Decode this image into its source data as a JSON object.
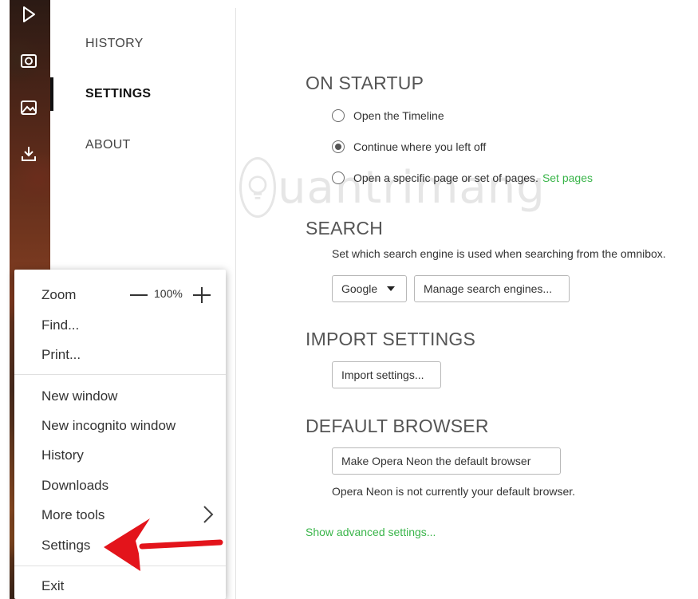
{
  "sidebar": {
    "icons": [
      "play-icon",
      "camera-icon",
      "image-icon",
      "download-icon"
    ]
  },
  "nav": {
    "items": [
      {
        "label": "HISTORY",
        "active": false
      },
      {
        "label": "SETTINGS",
        "active": true
      },
      {
        "label": "ABOUT",
        "active": false
      }
    ]
  },
  "startup": {
    "title": "ON STARTUP",
    "options": [
      {
        "label": "Open the Timeline",
        "checked": false
      },
      {
        "label": "Continue where you left off",
        "checked": true
      },
      {
        "label": "Open a specific page or set of pages.",
        "checked": false,
        "link": "Set pages"
      }
    ]
  },
  "search": {
    "title": "SEARCH",
    "description": "Set which search engine is used when searching from the omnibox.",
    "engine": "Google",
    "manage_label": "Manage search engines..."
  },
  "import": {
    "title": "IMPORT SETTINGS",
    "button_label": "Import settings..."
  },
  "default_browser": {
    "title": "DEFAULT BROWSER",
    "button_label": "Make Opera Neon the default browser",
    "status": "Opera Neon is not currently your default browser."
  },
  "advanced_link": "Show advanced settings...",
  "menu": {
    "zoom_label": "Zoom",
    "zoom_value": "100%",
    "find": "Find...",
    "print": "Print...",
    "new_window": "New window",
    "new_incognito": "New incognito window",
    "history": "History",
    "downloads": "Downloads",
    "more_tools": "More tools",
    "settings": "Settings",
    "exit": "Exit"
  },
  "colors": {
    "accent_green": "#3ab54a",
    "arrow_red": "#e3141b"
  }
}
